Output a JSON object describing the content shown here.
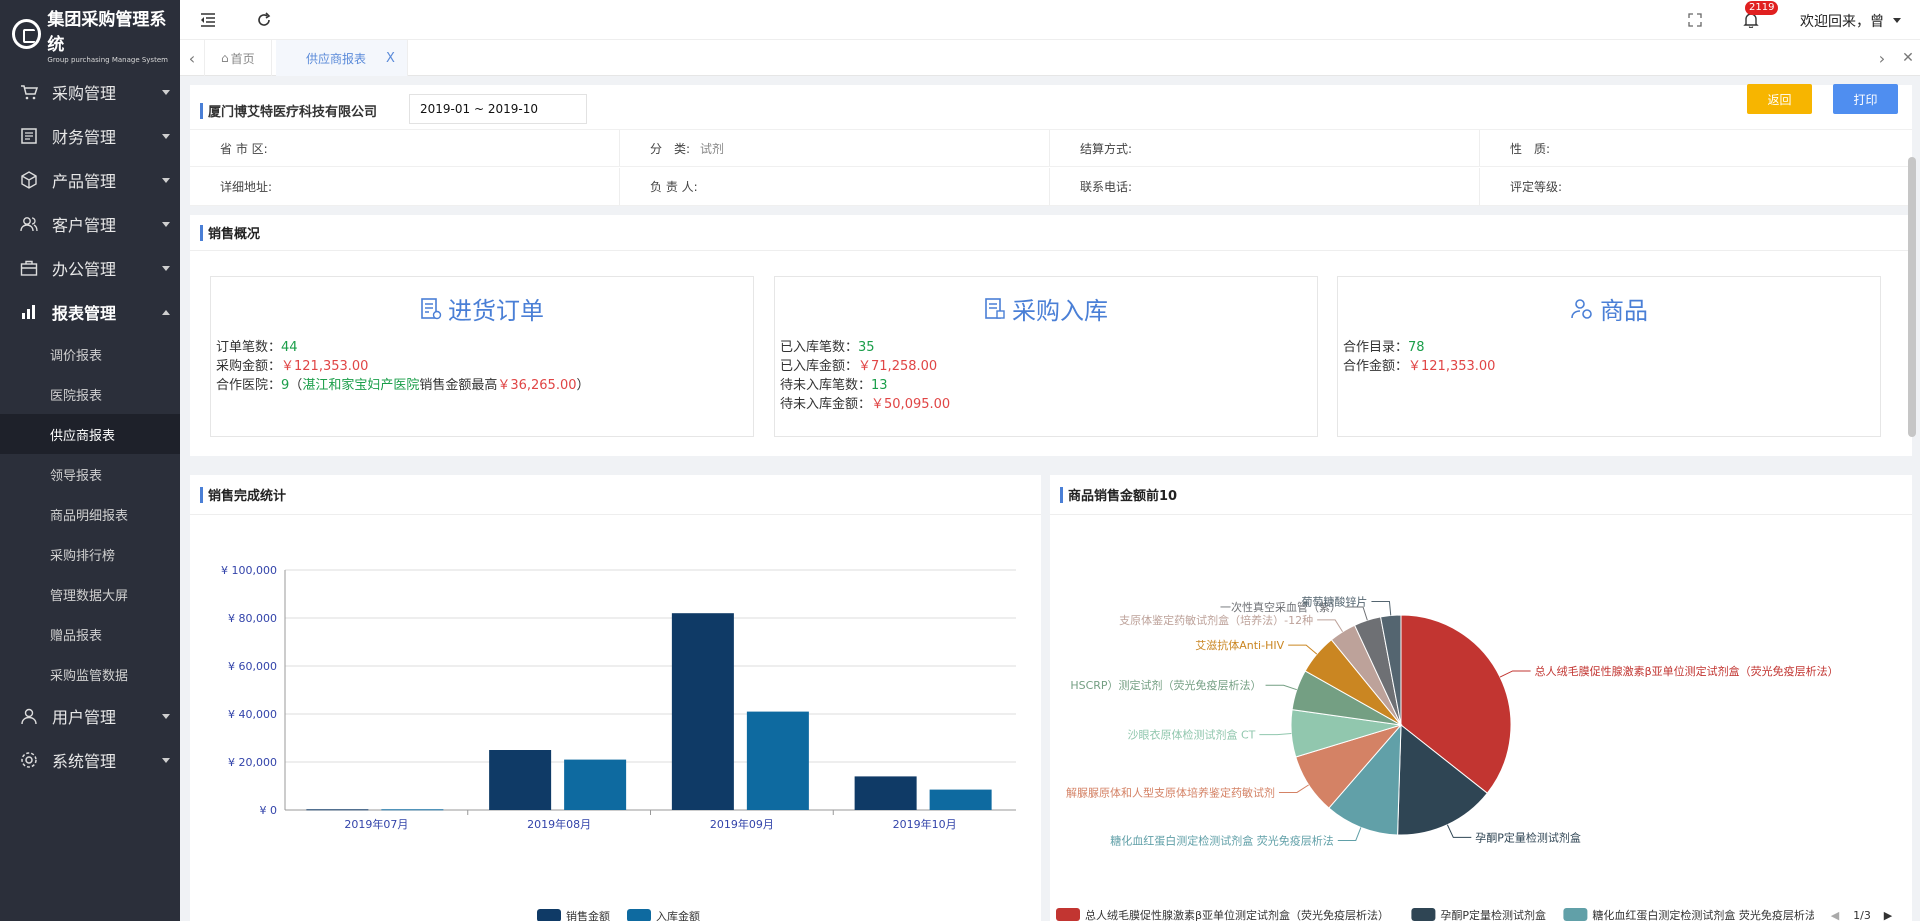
{
  "app": {
    "title": "集团采购管理系统",
    "subtitle": "Group purchasing Manage System"
  },
  "sidebar": {
    "menus": [
      {
        "label": "采购管理",
        "icon": "cart-icon"
      },
      {
        "label": "财务管理",
        "icon": "finance-icon"
      },
      {
        "label": "产品管理",
        "icon": "cube-icon"
      },
      {
        "label": "客户管理",
        "icon": "users-icon"
      },
      {
        "label": "办公管理",
        "icon": "briefcase-icon"
      },
      {
        "label": "报表管理",
        "icon": "bar-chart-icon"
      }
    ],
    "report_sub": [
      "调价报表",
      "医院报表",
      "供应商报表",
      "领导报表",
      "商品明细报表",
      "采购排行榜",
      "管理数据大屏",
      "赠品报表",
      "采购监管数据"
    ],
    "menus_after": [
      {
        "label": "用户管理",
        "icon": "user-icon"
      },
      {
        "label": "系统管理",
        "icon": "settings-icon"
      }
    ]
  },
  "header": {
    "notification_count": "2119",
    "welcome": "欢迎回来，曾"
  },
  "tabs": {
    "home": "首页",
    "active": "供应商报表",
    "close": "X"
  },
  "supplier": {
    "name": "厦门博艾特医疗科技有限公司",
    "date_range": "2019-01 ~ 2019-10",
    "back_label": "返回",
    "print_label": "打印",
    "info": [
      [
        {
          "label": "省 市 区:",
          "value": ""
        },
        {
          "label": "分　类:",
          "value": "试剂"
        },
        {
          "label": "结算方式:",
          "value": ""
        },
        {
          "label": "性　质:",
          "value": ""
        }
      ],
      [
        {
          "label": "详细地址:",
          "value": ""
        },
        {
          "label": "负 责 人:",
          "value": ""
        },
        {
          "label": "联系电话:",
          "value": ""
        },
        {
          "label": "评定等级:",
          "value": ""
        }
      ]
    ]
  },
  "overview": {
    "title": "销售概况",
    "orders": {
      "title": "进货订单",
      "count_label": "订单笔数：",
      "count": "44",
      "amount_label": "采购金额：",
      "amount": "￥121,353.00",
      "hosp_label": "合作医院：",
      "hosp_count": "9",
      "hosp_open": "（",
      "top_hospital": "湛江和家宝妇产医院",
      "top_text": "销售金额最高",
      "top_amount": "￥36,265.00",
      "hosp_close": "）"
    },
    "inbound": {
      "title": "采购入库",
      "l1": "已入库笔数：",
      "v1": "35",
      "l2": "已入库金额：",
      "v2": "￥71,258.00",
      "l3": "待未入库笔数：",
      "v3": "13",
      "l4": "待未入库金额：",
      "v4": "￥50,095.00"
    },
    "products": {
      "title": "商品",
      "l1": "合作目录：",
      "v1": "78",
      "l2": "合作金额：",
      "v2": "￥121,353.00"
    }
  },
  "sales_chart_title": "销售完成统计",
  "top10_title": "商品销售金额前10",
  "chart_data": [
    {
      "type": "bar",
      "categories": [
        "2019年07月",
        "2019年08月",
        "2019年09月",
        "2019年10月"
      ],
      "series": [
        {
          "name": "销售金额",
          "values": [
            300,
            25000,
            82000,
            14000
          ],
          "color": "#0f3a66"
        },
        {
          "name": "入库金额",
          "values": [
            300,
            21000,
            41000,
            8500
          ],
          "color": "#0e6aa0"
        }
      ],
      "ylim": [
        0,
        100000
      ],
      "yticks": [
        "¥ 0",
        "¥ 20,000",
        "¥ 40,000",
        "¥ 60,000",
        "¥ 80,000",
        "¥ 100,000"
      ],
      "grid": true,
      "legend": "bottom"
    },
    {
      "type": "pie",
      "slices": [
        {
          "label": "总人绒毛膜促性腺激素β亚单位测定试剂盒（荧光免疫层析法）",
          "value": 36,
          "color": "#c23531"
        },
        {
          "label": "孕酮P定量检测试剂盒",
          "value": 15,
          "color": "#2f4554"
        },
        {
          "label": "糖化血红蛋白测定检测试剂盒 荧光免疫层析法",
          "value": 11,
          "color": "#61a0a8"
        },
        {
          "label": "解脲脲原体和人型支原体培养鉴定药敏试剂",
          "value": 9,
          "color": "#d48265"
        },
        {
          "label": "沙眼衣原体检测试剂盒 CT",
          "value": 7,
          "color": "#91c7ae"
        },
        {
          "label": "HSCRP）测定试剂（荧光免疫层析法）",
          "value": 6,
          "color": "#749f83"
        },
        {
          "label": "艾滋抗体Anti-HIV",
          "value": 6,
          "color": "#ca8622"
        },
        {
          "label": "支原体鉴定药敏试剂盒（培养法）-12种",
          "value": 4,
          "color": "#bda29a"
        },
        {
          "label": "一次性真空采血管（紫）",
          "value": 4,
          "color": "#6e7074"
        },
        {
          "label": "葡萄糖酸锌片",
          "value": 3,
          "color": "#546570"
        }
      ],
      "legend": "bottom",
      "legend_items": [
        "总人绒毛膜促性腺激素β亚单位测定试剂盒（荧光免疫层析法）",
        "孕酮P定量检测试剂盒",
        "糖化血红蛋白测定检测试剂盒 荧光免疫层析法"
      ],
      "legend_page": "1/3"
    }
  ]
}
